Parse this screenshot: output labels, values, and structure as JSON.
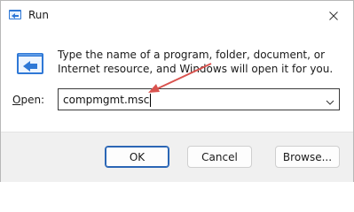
{
  "window": {
    "title": "Run",
    "icons": {
      "app": "run-app-icon",
      "close": "close-icon",
      "run": "run-program-icon",
      "dropdown": "chevron-down-icon"
    }
  },
  "content": {
    "description": "Type the name of a program, folder, document, or Internet resource, and Windows will open it for you.",
    "open_label_accel": "O",
    "open_label_rest": "pen:",
    "open_value": "compmgmt.msc"
  },
  "buttons": {
    "ok": "OK",
    "cancel": "Cancel",
    "browse": "Browse..."
  },
  "colors": {
    "annotation_arrow": "#d9534f",
    "accent": "#2b66b5"
  }
}
